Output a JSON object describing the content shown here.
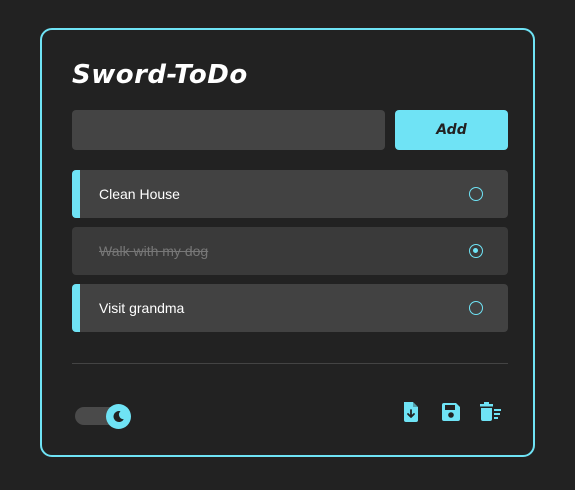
{
  "app": {
    "title": "Sword-ToDo"
  },
  "input": {
    "value": "",
    "placeholder": ""
  },
  "add_button": {
    "label": "Add"
  },
  "todos": [
    {
      "text": "Clean House",
      "done": false
    },
    {
      "text": "Walk with my dog",
      "done": true
    },
    {
      "text": "Visit grandma",
      "done": false
    }
  ],
  "theme": {
    "mode": "dark",
    "accent": "#6fe3f5",
    "background": "#222222"
  },
  "footer": {
    "theme_toggle_icon": "moon-icon",
    "actions": [
      "file-download-icon",
      "save-icon",
      "clear-list-icon"
    ]
  }
}
